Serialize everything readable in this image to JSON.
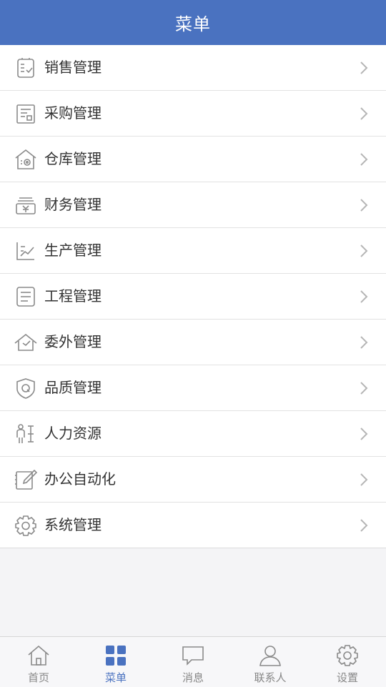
{
  "header": {
    "title": "菜单"
  },
  "menu": [
    {
      "label": "销售管理",
      "icon": "sales-clipboard-icon"
    },
    {
      "label": "采购管理",
      "icon": "purchase-document-icon"
    },
    {
      "label": "仓库管理",
      "icon": "warehouse-gear-icon"
    },
    {
      "label": "财务管理",
      "icon": "finance-yen-icon"
    },
    {
      "label": "生产管理",
      "icon": "production-chart-icon"
    },
    {
      "label": "工程管理",
      "icon": "engineering-document-icon"
    },
    {
      "label": "委外管理",
      "icon": "outsourcing-house-icon"
    },
    {
      "label": "品质管理",
      "icon": "quality-shield-icon"
    },
    {
      "label": "人力资源",
      "icon": "human-resources-icon"
    },
    {
      "label": "办公自动化",
      "icon": "office-edit-icon"
    },
    {
      "label": "系统管理",
      "icon": "system-gear-icon"
    }
  ],
  "tabbar": {
    "active_index": 1,
    "active_color": "#4a72c0",
    "tabs": [
      {
        "label": "首页",
        "icon": "home-icon"
      },
      {
        "label": "菜单",
        "icon": "menu-grid-icon"
      },
      {
        "label": "消息",
        "icon": "message-bubble-icon"
      },
      {
        "label": "联系人",
        "icon": "contact-person-icon"
      },
      {
        "label": "设置",
        "icon": "settings-gear-icon"
      }
    ]
  },
  "colors": {
    "header_bg": "#4a72c0",
    "page_bg": "#f4f4f6",
    "icon_gray": "#8a8a8a"
  }
}
